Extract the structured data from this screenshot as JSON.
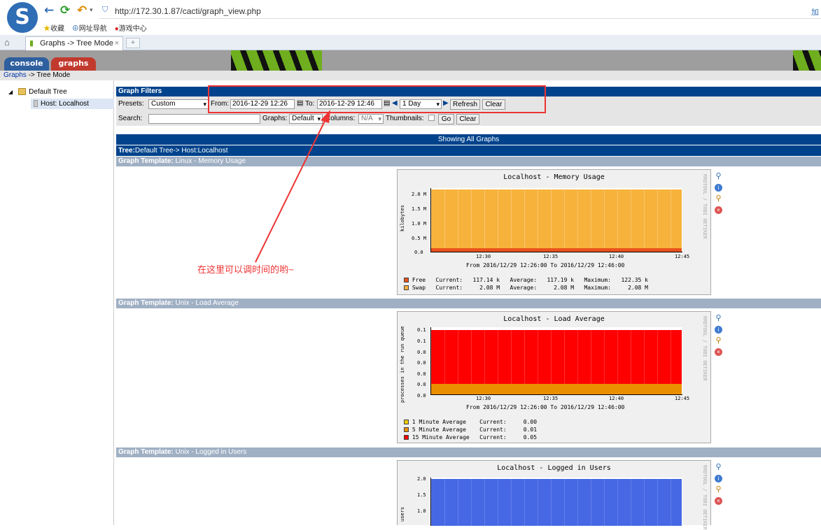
{
  "browser": {
    "url": "http://172.30.1.87/cacti/graph_view.php",
    "bookmarks": [
      "收藏",
      "网址导航",
      "游戏中心"
    ],
    "tab_title": "Graphs -> Tree Mode",
    "corner_text": "加"
  },
  "cacti": {
    "tabs": [
      "console",
      "graphs"
    ],
    "breadcrumb_link": "Graphs",
    "breadcrumb_rest": "-> Tree Mode"
  },
  "tree": {
    "root": "Default Tree",
    "host": "Host: Localhost"
  },
  "filters": {
    "header": "Graph Filters",
    "presets_label": "Presets:",
    "presets_value": "Custom",
    "from_label": "From:",
    "from_value": "2016-12-29 12:26",
    "to_label": "To:",
    "to_value": "2016-12-29 12:46",
    "span_value": "1 Day",
    "refresh": "Refresh",
    "clear": "Clear",
    "search_label": "Search:",
    "search_value": "",
    "graphs_label": "Graphs:",
    "graphs_value": "Default",
    "columns_label": "Columns:",
    "columns_value": "N/A",
    "thumbs_label": "Thumbnails:",
    "go": "Go",
    "clear2": "Clear"
  },
  "showing": "Showing All Graphs",
  "tree_path_label": "Tree:",
  "tree_path": "Default Tree-> Host:Localhost",
  "templates": [
    {
      "label": "Graph Template:",
      "name": "Linux - Memory Usage"
    },
    {
      "label": "Graph Template:",
      "name": "Unix - Load Average"
    },
    {
      "label": "Graph Template:",
      "name": "Unix - Logged in Users"
    }
  ],
  "annotation": "在这里可以调时间的哟~",
  "vendor_text": "RRDTOOL / TOBI OETIKER",
  "graphs": {
    "mem": {
      "title": "Localhost - Memory Usage",
      "ylabel": "kilobytes",
      "yticks": [
        "2.0 M",
        "1.5 M",
        "1.0 M",
        "0.5 M",
        "0.0"
      ],
      "xticks": [
        "12:30",
        "12:35",
        "12:40",
        "12:45"
      ],
      "range": "From 2016/12/29 12:26:00 To 2016/12/29 12:46:00",
      "legend": [
        "Free   Current:   117.14 k   Average:   117.19 k   Maximum:   122.35 k",
        "Swap   Current:     2.08 M   Average:     2.08 M   Maximum:     2.08 M"
      ],
      "colors": [
        "#e8521c",
        "#f7b23b"
      ]
    },
    "load": {
      "title": "Localhost - Load Average",
      "ylabel": "processes in the run queue",
      "yticks": [
        "0.1",
        "0.1",
        "0.0",
        "0.0",
        "0.0",
        "0.0",
        "0.0"
      ],
      "xticks": [
        "12:30",
        "12:35",
        "12:40",
        "12:45"
      ],
      "range": "From 2016/12/29 12:26:00 To 2016/12/29 12:46:00",
      "legend": [
        "1 Minute Average    Current:     0.00",
        "5 Minute Average    Current:     0.01",
        "15 Minute Average   Current:     0.05"
      ],
      "colors": [
        "#eacc00",
        "#ea8f00",
        "#ff0000"
      ]
    },
    "users": {
      "title": "Localhost - Logged in Users",
      "ylabel": "users",
      "yticks": [
        "2.0",
        "1.5",
        "1.0"
      ],
      "colors": [
        "#4668e4"
      ]
    }
  }
}
